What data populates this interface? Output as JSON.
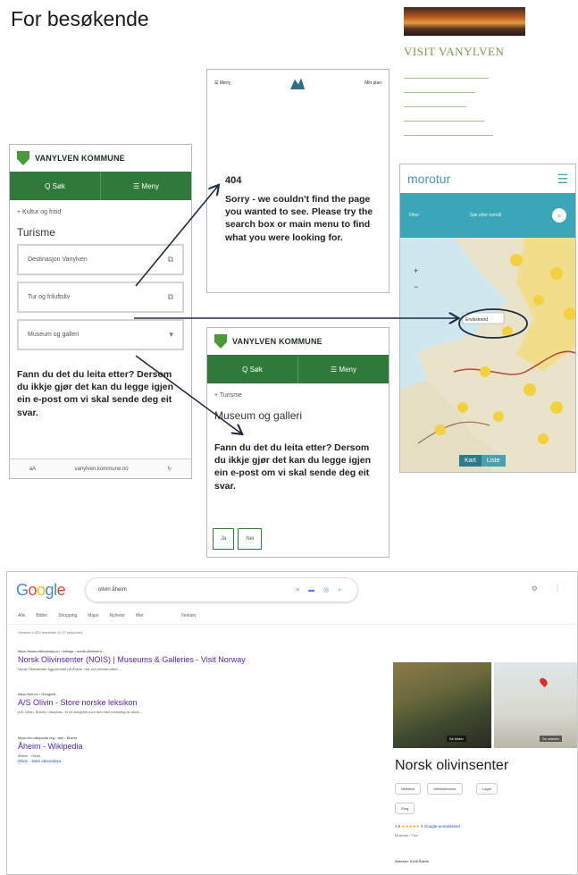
{
  "page": {
    "title": "For besøkende"
  },
  "visit_vanylven": {
    "title": "VISIT VANYLVEN",
    "links": [
      "",
      "",
      "",
      "",
      ""
    ]
  },
  "kommune_turisme": {
    "brand": "VANYLVEN KOMMUNE",
    "search_label": "Q Søk",
    "menu_label": "☰ Meny",
    "breadcrumb": "+ Kultur og fritid",
    "heading": "Turisme",
    "rows": [
      {
        "label": "Destinasjon Vanylven",
        "icon": "external-link"
      },
      {
        "label": "Tur og friluftsliv",
        "icon": "external-link"
      },
      {
        "label": "Museum og galleri",
        "icon": "chevron-down"
      }
    ],
    "prompt": "Fann du det du leita etter? Dersom du ikkje gjør det kan du legge igjen ein e-post om vi skal sende deg eit svar.",
    "footer": {
      "left": "aA",
      "url": "vanylven.kommune.no",
      "right": "↻"
    }
  },
  "error_page": {
    "menu": "☰ Meny",
    "mypage": "Min plan",
    "code": "404",
    "message": "Sorry - we couldn't find the page you wanted to see. Please try the search box or main menu to find what you were looking for."
  },
  "kommune_museum": {
    "brand": "VANYLVEN KOMMUNE",
    "search_label": "Q Søk",
    "menu_label": "☰ Meny",
    "breadcrumb": "+ Turisme",
    "heading": "Museum og galleri",
    "prompt": "Fann du det du leita etter? Dersom du ikkje gjør det kan du legge igjen ein e-post om vi skal sende deg eit svar.",
    "buttons": [
      "Ja",
      "Nei"
    ]
  },
  "morotur": {
    "brand": "morotur",
    "filter_label": "Filter",
    "search_placeholder": "Søk etter turmål",
    "callout": "Ervikstrand",
    "tabs": [
      "Kart",
      "Liste"
    ]
  },
  "google": {
    "query": "olivin åheim",
    "tabs": [
      "Alle",
      "Bilder",
      "Shopping",
      "Maps",
      "Nyheter",
      "Mer"
    ],
    "tools": "Verktøy",
    "result_count": "Omtrent 4 420 resultater (0,37 sekunder)",
    "results": [
      {
        "url": "https://www.visitnorway.no › listings › norsk-olivinsent...",
        "title": "Norsk Olivinsenter (NOIS) | Museums & Galleries - Visit Norway",
        "snippet": "Norsk Olivinsenter ligg sentralt på Åheim, rett ved olivinbruddet ..."
      },
      {
        "url": "https://snl.no › Geografi",
        "title": "A/S Olivin - Store norske leksikon",
        "snippet": "A/S Olivin, Åheim i Vanylven, er eit bergverk som driv med utvinning av olivin ..."
      },
      {
        "url": "https://no.wikipedia.org › wiki › Åheim",
        "title": "Åheim - Wikipedia",
        "snippet": "Åheim · Olivin",
        "links": "Olivin · Søre Jøsundøya"
      }
    ],
    "panel": {
      "title": "Norsk olivinsenter",
      "photo_label": "Se bilder",
      "map_label": "Se utsiden",
      "chips": [
        "Nettsted",
        "Veibeskrivelse",
        "Lagre",
        "Ring"
      ],
      "rating": "4,6",
      "stars": "★★★★★",
      "review_text": "9 Google-anmeldelser",
      "type": "Museum i Tive",
      "address": "Adresse: 6146 Åheim"
    }
  }
}
